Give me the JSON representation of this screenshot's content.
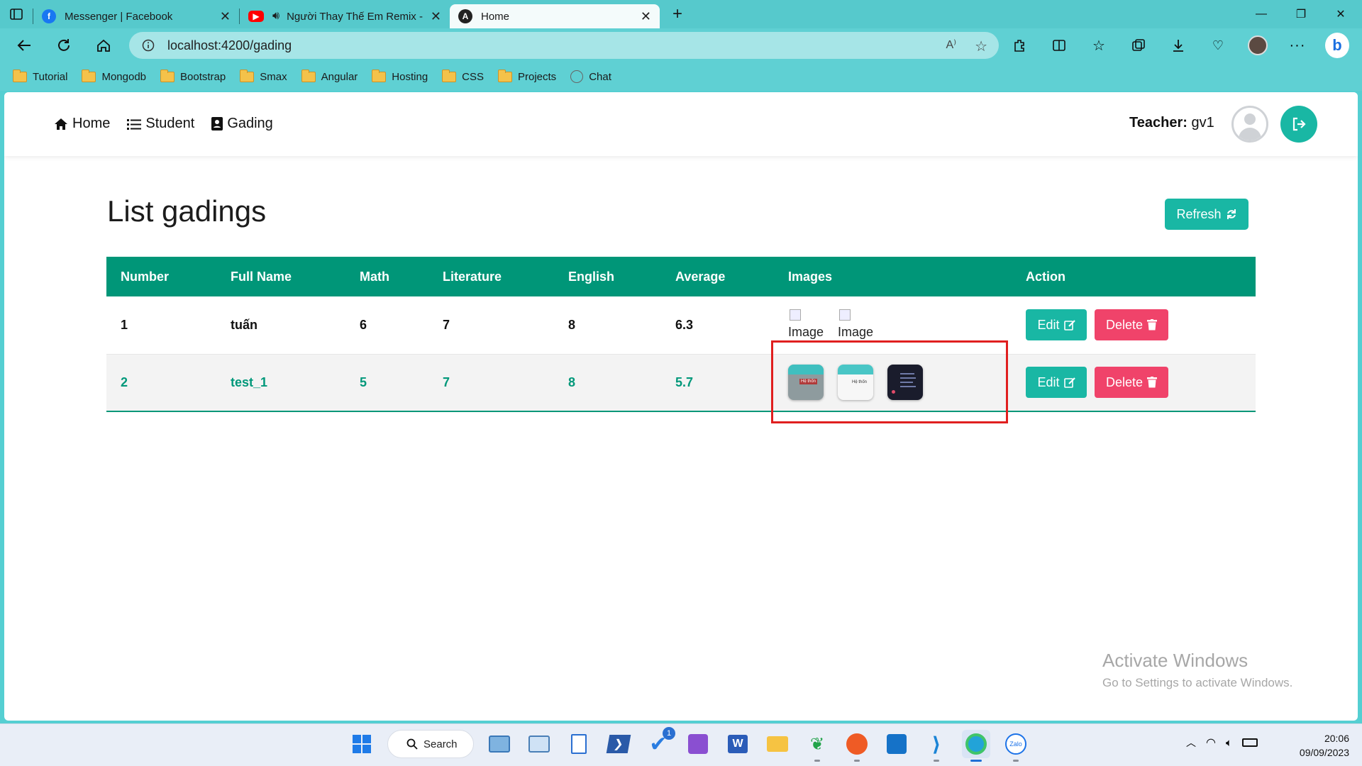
{
  "browser": {
    "tabs": [
      {
        "title": "Messenger | Facebook",
        "icon": "facebook-icon",
        "active": false
      },
      {
        "title": "Người Thay Thế Em Remix -",
        "icon": "youtube-icon",
        "active": false
      },
      {
        "title": "Home",
        "icon": "angular-icon",
        "active": true
      }
    ],
    "url": "localhost:4200/gading",
    "bookmarks": [
      "Tutorial",
      "Mongodb",
      "Bootstrap",
      "Smax",
      "Angular",
      "Hosting",
      "CSS",
      "Projects",
      "Chat"
    ]
  },
  "app": {
    "nav": {
      "home": "Home",
      "student": "Student",
      "gading": "Gading"
    },
    "teacher_label": "Teacher:",
    "teacher_name": "gv1",
    "page_title": "List gadings",
    "refresh_label": "Refresh",
    "table": {
      "headers": [
        "Number",
        "Full Name",
        "Math",
        "Literature",
        "English",
        "Average",
        "Images",
        "Action"
      ],
      "rows": [
        {
          "number": "1",
          "name": "tuấn",
          "math": "6",
          "literature": "7",
          "english": "8",
          "average": "6.3"
        },
        {
          "number": "2",
          "name": "test_1",
          "math": "5",
          "literature": "7",
          "english": "8",
          "average": "5.7"
        }
      ],
      "broken_image_alt": "Image",
      "thumb_label": "Hệ thốn",
      "edit_label": "Edit",
      "delete_label": "Delete"
    }
  },
  "overlay": {
    "activate_title": "Activate Windows",
    "activate_sub": "Go to Settings to activate Windows."
  },
  "taskbar": {
    "search_label": "Search",
    "badge": "1",
    "zalo_label": "Zalo",
    "time": "20:06",
    "date": "09/09/2023"
  },
  "colors": {
    "accent": "#19b7a4",
    "table_header": "#009678",
    "delete": "#f0436a",
    "highlight": "#e01f1f"
  }
}
